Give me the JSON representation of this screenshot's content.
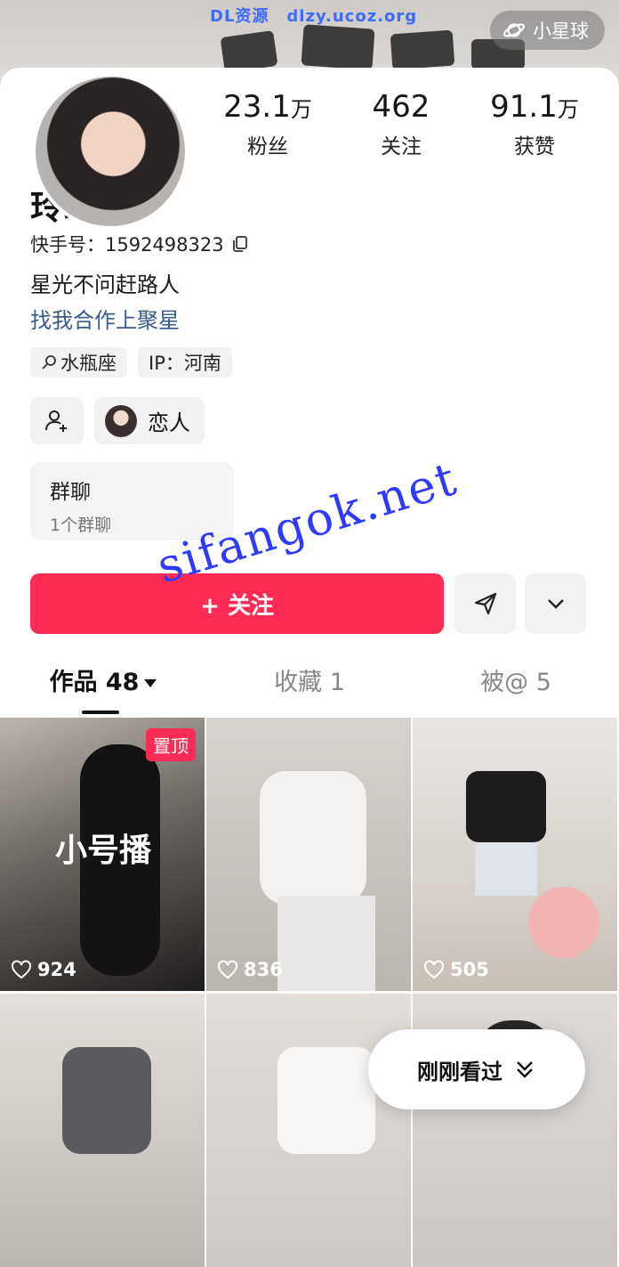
{
  "watermark_top": {
    "left": "DL资源",
    "right": "dlzy.ucoz.org"
  },
  "planet_label": "小星球",
  "stats": [
    {
      "num": "23.1",
      "unit": "万",
      "label": "粉丝"
    },
    {
      "num": "462",
      "unit": "",
      "label": "关注"
    },
    {
      "num": "91.1",
      "unit": "万",
      "label": "获赞"
    }
  ],
  "profile": {
    "name": "玲玲",
    "kuaishou_id": "快手号：1592498323",
    "bio": "星光不问赶路人",
    "link": "找我合作上聚星",
    "tags": [
      "水瓶座",
      "IP：河南"
    ],
    "relation": "恋人"
  },
  "group": {
    "title": "群聊",
    "sub": "1个群聊"
  },
  "follow_label": "+ 关注",
  "watermark_mid": "sifangok.net",
  "tabs": [
    {
      "label": "作品 48"
    },
    {
      "label": "收藏 1"
    },
    {
      "label": "被@ 5"
    }
  ],
  "videos": [
    {
      "likes": "924",
      "pin": "置顶",
      "overlay": "小号播"
    },
    {
      "likes": "836"
    },
    {
      "likes": "505"
    },
    {
      "likes": ""
    },
    {
      "likes": ""
    },
    {
      "likes": ""
    }
  ],
  "recent_label": "刚刚看过",
  "colors": {
    "accent": "#fe2c55",
    "link": "#3a5a8c"
  }
}
